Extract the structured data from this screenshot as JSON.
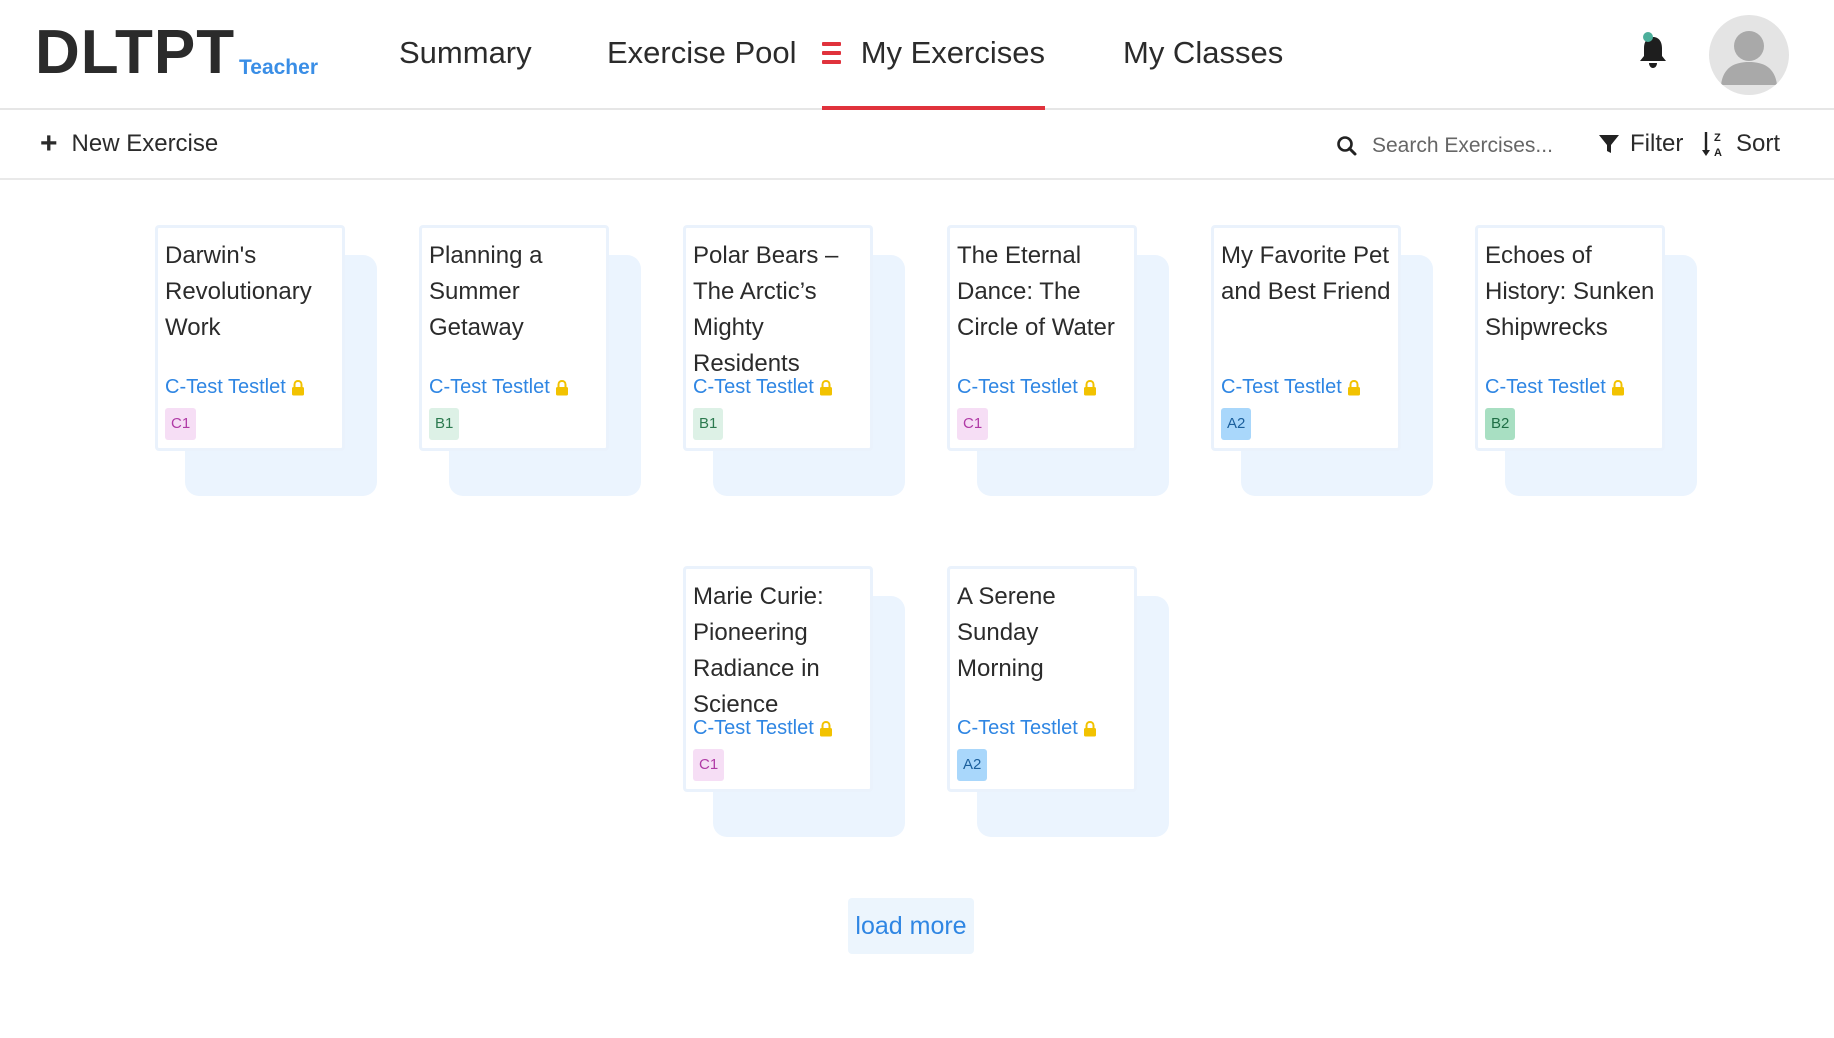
{
  "header": {
    "logo": "DLTPT",
    "role": "Teacher",
    "nav": {
      "summary": "Summary",
      "exercise_pool": "Exercise Pool",
      "my_exercises": "My Exercises",
      "my_classes": "My Classes"
    },
    "active_tab": "My Exercises",
    "accent_color": "#e0323c"
  },
  "toolbar": {
    "new_exercise": "New Exercise",
    "search_placeholder": "Search Exercises...",
    "filter": "Filter",
    "sort": "Sort"
  },
  "exercises": [
    {
      "title": "Darwin's Revolutionary Work",
      "type": "C-Test Testlet",
      "level": "C1",
      "locked": true
    },
    {
      "title": "Planning a Summer Getaway",
      "type": "C-Test Testlet",
      "level": "B1",
      "locked": true
    },
    {
      "title": "Polar Bears – The Arctic’s Mighty Residents",
      "type": "C-Test Testlet",
      "level": "B1",
      "locked": true
    },
    {
      "title": "The Eternal Dance: The Circle of Water",
      "type": "C-Test Testlet",
      "level": "C1",
      "locked": true
    },
    {
      "title": "My Favorite Pet and Best Friend",
      "type": "C-Test Testlet",
      "level": "A2",
      "locked": true
    },
    {
      "title": "Echoes of History: Sunken Shipwrecks",
      "type": "C-Test Testlet",
      "level": "B2",
      "locked": true
    },
    {
      "title": "Marie Curie: Pioneering Radiance in Science",
      "type": "C-Test Testlet",
      "level": "C1",
      "locked": true
    },
    {
      "title": "A Serene Sunday Morning",
      "type": "C-Test Testlet",
      "level": "A2",
      "locked": true
    }
  ],
  "load_more": "load more",
  "colors": {
    "link_blue": "#2f86e3",
    "lock_yellow": "#f2c200",
    "card_shadow": "#ebf4fe"
  }
}
